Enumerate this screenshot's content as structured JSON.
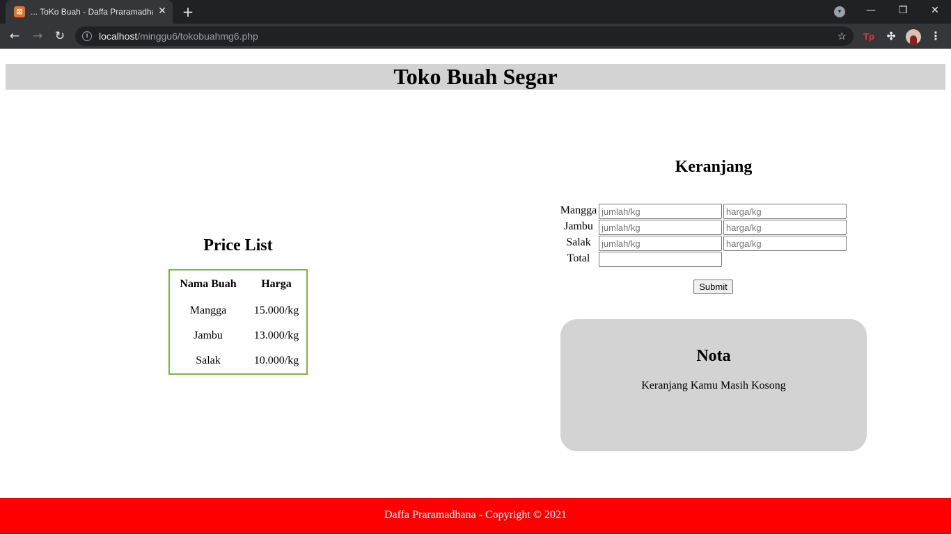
{
  "browser": {
    "tab_title": "... ToKo Buah - Daffa Praramadhana",
    "tab_close_icon": "✕",
    "new_tab_icon": "+",
    "url_host": "localhost",
    "url_path": "/minggu6/tokobuahmg6.php",
    "ext_tp_label": "Tp",
    "ext_tp_color": "#e53935"
  },
  "page": {
    "title": "Toko Buah Segar"
  },
  "price_list": {
    "title": "Price List",
    "headers": [
      "Nama Buah",
      "Harga"
    ],
    "rows": [
      {
        "name": "Mangga",
        "price": "15.000/kg"
      },
      {
        "name": "Jambu",
        "price": "13.000/kg"
      },
      {
        "name": "Salak",
        "price": "10.000/kg"
      }
    ],
    "border_color": "#7cb342"
  },
  "cart": {
    "title": "Keranjang",
    "items": [
      {
        "label": "Mangga",
        "qty_placeholder": "jumlah/kg",
        "price_placeholder": "harga/kg"
      },
      {
        "label": "Jambu",
        "qty_placeholder": "jumlah/kg",
        "price_placeholder": "harga/kg"
      },
      {
        "label": "Salak",
        "qty_placeholder": "jumlah/kg",
        "price_placeholder": "harga/kg"
      }
    ],
    "total_label": "Total",
    "total_value": "",
    "submit_label": "Submit"
  },
  "nota": {
    "title": "Nota",
    "message": "Keranjang Kamu Masih Kosong"
  },
  "footer": {
    "text": "Daffa Praramadhana - Copyright © 2021",
    "background": "#ff0000"
  }
}
